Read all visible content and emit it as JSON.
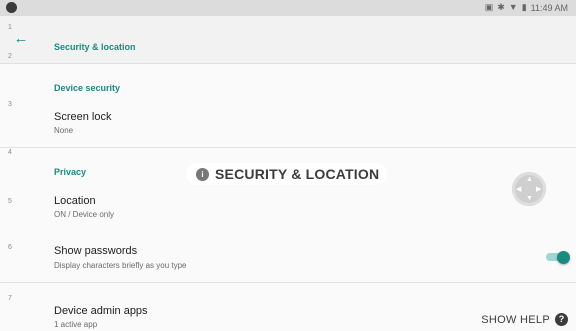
{
  "status_bar": {
    "time": "11:49 AM",
    "icons": [
      "nfc-icon",
      "bluetooth-icon",
      "wifi-icon",
      "battery-icon"
    ]
  },
  "app_bar": {
    "title": "Security & location",
    "back_icon": "arrow-left-icon"
  },
  "steps": [
    "1",
    "2",
    "3",
    "4",
    "5",
    "6",
    "7"
  ],
  "sections": {
    "device_security": "Device security",
    "privacy": "Privacy"
  },
  "rows": {
    "screen_lock": {
      "title": "Screen lock",
      "subtitle": "None"
    },
    "location": {
      "title": "Location",
      "subtitle": "ON / Device only"
    },
    "show_passwords": {
      "title": "Show passwords",
      "subtitle": "Display characters briefly as you type",
      "toggle_on": true
    },
    "device_admin": {
      "title": "Device admin apps",
      "subtitle": "1 active app"
    }
  },
  "overlay": {
    "label": "SECURITY & LOCATION",
    "icon": "info-icon"
  },
  "help": {
    "label": "SHOW HELP",
    "icon": "question-icon"
  },
  "colors": {
    "accent": "#1a8b80",
    "toggle_track": "#9fd6d0"
  }
}
